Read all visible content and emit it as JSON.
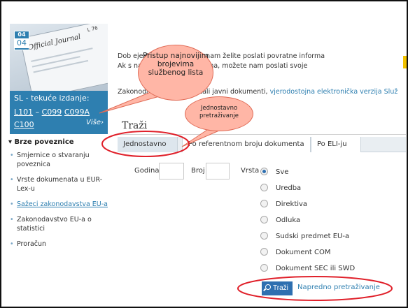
{
  "oj": {
    "cover_title": "Official Journal",
    "cover_num": "L 76",
    "date_month": "04",
    "date_day": "04",
    "caption": "SL - tekuće izdanje:",
    "links": [
      "L101",
      "C099",
      "C099A",
      "C100"
    ],
    "more": "Više›"
  },
  "sidebar": {
    "title": "▾ Brze poveznice",
    "items": [
      {
        "label": "Smjernice o stvaranju poveznica",
        "link": false
      },
      {
        "label": "Vrste dokumenata u EUR-Lex-u",
        "link": false
      },
      {
        "label": "Sažeci zakonodavstva EU-a",
        "link": true
      },
      {
        "label": "Zakonodavstvo EU-a o statistici",
        "link": false
      },
      {
        "label": "Proračun",
        "link": false
      }
    ]
  },
  "intro": {
    "line1": "Dob             ejesto EUR-Lexa! Ako nam želite poslati povratne informa",
    "line2": "Ak               s najnovijim informacijama, možete nam poslati svoje",
    "legal_prefix": "Zakonodavstvo EU-a i ostali javni dokumenti, ",
    "legal_link": "vjerodostojna elektronička verzija Služ"
  },
  "search": {
    "title": "Traži",
    "tabs": [
      "Jednostavno",
      "Po referentnom broju dokumenta",
      "Po ELI-ju"
    ],
    "godina_label": "Godina",
    "broj_label": "Broj",
    "vrsta_label": "Vrsta",
    "types": [
      "Sve",
      "Uredba",
      "Direktiva",
      "Odluka",
      "Sudski predmet EU-a",
      "Dokument COM",
      "Dokument SEC ili SWD"
    ],
    "selected_type": "Sve",
    "search_button": "Traži",
    "advanced_link": "Napredno pretraživanje"
  },
  "annotations": {
    "big_callout": "Pristup najnovijim brojevima službenog lista",
    "small_callout": "Jednostavno pretraživanje"
  }
}
